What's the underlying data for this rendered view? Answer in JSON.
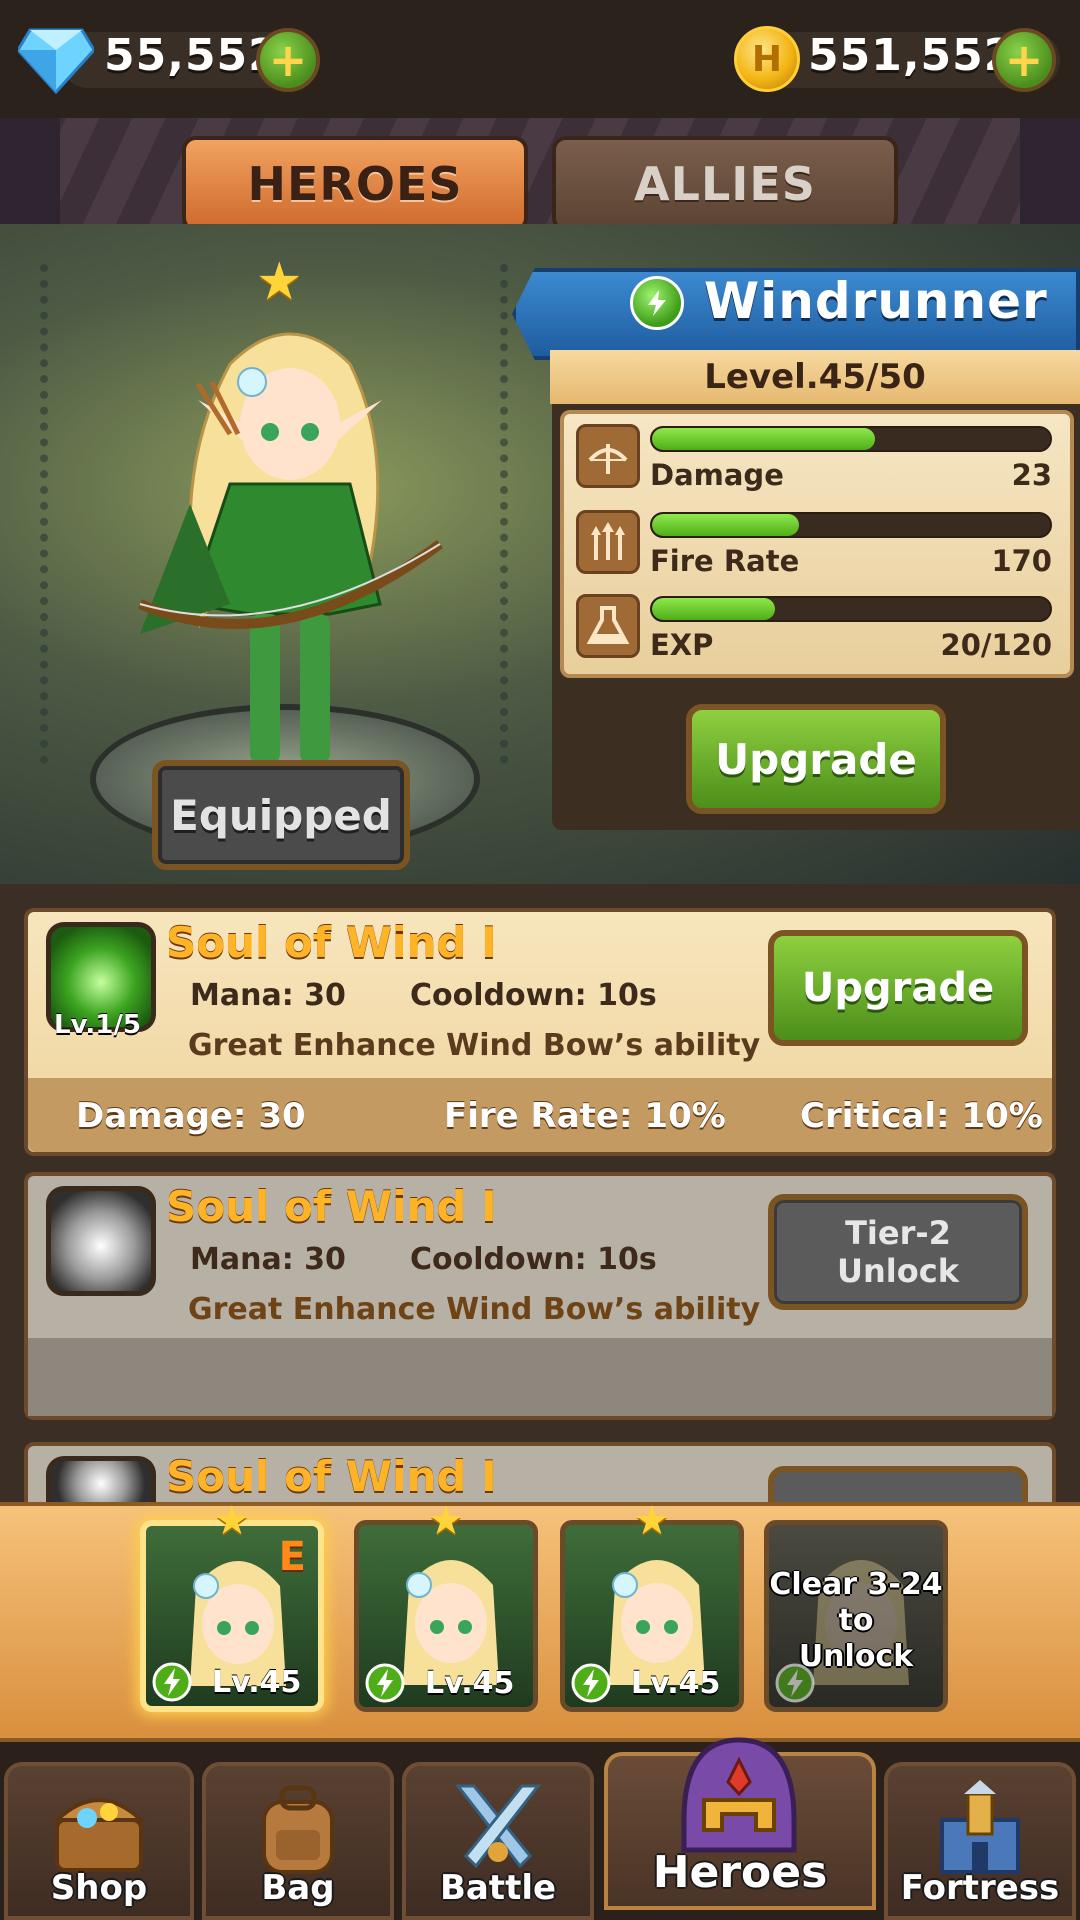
{
  "currency": {
    "gems": "55,552",
    "coins": "551,552",
    "coin_symbol": "H"
  },
  "tabs": [
    {
      "label": "HEROES",
      "active": true
    },
    {
      "label": "ALLIES",
      "active": false
    }
  ],
  "hero": {
    "name": "Windrunner",
    "level": "Level.45/50",
    "equipped_label": "Equipped",
    "upgrade_label": "Upgrade",
    "stats": [
      {
        "label": "Damage",
        "value": "23",
        "fill": 0.56,
        "icon": "bow-icon"
      },
      {
        "label": "Fire Rate",
        "value": "170",
        "fill": 0.37,
        "icon": "triple-arrow-icon"
      },
      {
        "label": "EXP",
        "value": "20/120",
        "fill": 0.31,
        "icon": "flask-icon"
      }
    ]
  },
  "skills": [
    {
      "title": "Soul of Wind I",
      "level": "Lv.1/5",
      "mana": "Mana: 30",
      "cooldown": "Cooldown: 10s",
      "description": "Great Enhance Wind Bow’s ability",
      "button": "Upgrade",
      "stats": [
        "Damage: 30",
        "Fire Rate: 10%",
        "Critical: 10%"
      ]
    },
    {
      "title": "Soul of Wind I",
      "mana": "Mana: 30",
      "cooldown": "Cooldown: 10s",
      "description": "Great Enhance Wind Bow’s ability",
      "button_line1": "Tier-2",
      "button_line2": "Unlock"
    },
    {
      "title": "Soul of Wind I"
    }
  ],
  "roster": [
    {
      "level": "Lv.45",
      "badge": "E",
      "selected": true
    },
    {
      "level": "Lv.45"
    },
    {
      "level": "Lv.45"
    },
    {
      "lock_text_1": "Clear 3-24",
      "lock_text_2": "to",
      "lock_text_3": "Unlock"
    }
  ],
  "nav": [
    {
      "label": "Shop",
      "icon": "treasure-chest-icon"
    },
    {
      "label": "Bag",
      "icon": "backpack-icon"
    },
    {
      "label": "Battle",
      "icon": "crossed-swords-icon"
    },
    {
      "label": "Heroes",
      "icon": "helmet-icon",
      "active": true
    },
    {
      "label": "Fortress",
      "icon": "fortress-icon"
    }
  ],
  "colors": {
    "accent_green": "#4fae17",
    "banner_blue": "#2a74bf",
    "skill_title": "#ffb428",
    "panel_cream": "#f3dfb3"
  }
}
